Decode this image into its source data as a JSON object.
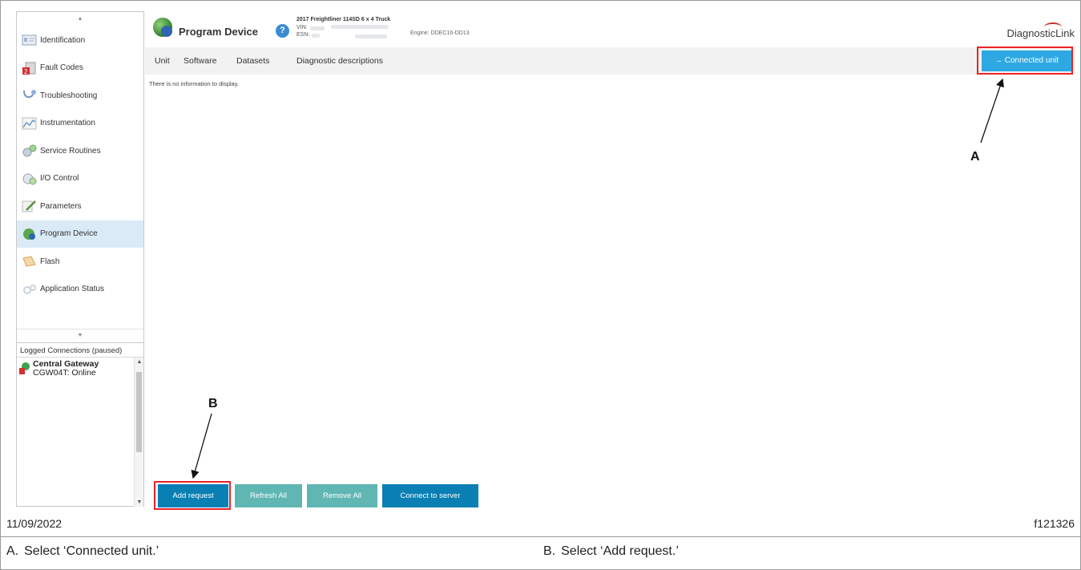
{
  "sidebar": {
    "items": [
      {
        "label": "Identification",
        "icon": "id-card-icon"
      },
      {
        "label": "Fault Codes",
        "icon": "fault-codes-icon"
      },
      {
        "label": "Troubleshooting",
        "icon": "stethoscope-icon"
      },
      {
        "label": "Instrumentation",
        "icon": "chart-icon"
      },
      {
        "label": "Service Routines",
        "icon": "gears-icon"
      },
      {
        "label": "I/O Control",
        "icon": "io-control-icon"
      },
      {
        "label": "Parameters",
        "icon": "pencil-icon"
      },
      {
        "label": "Program Device",
        "icon": "globe-icon",
        "active": true
      },
      {
        "label": "Flash",
        "icon": "flash-icon"
      },
      {
        "label": "Application Status",
        "icon": "status-icon"
      }
    ],
    "fault_badge": "2"
  },
  "logged": {
    "title": "Logged Connections (paused)",
    "connection_name": "Central Gateway",
    "connection_status": "CGW04T: Online"
  },
  "header": {
    "title": "Program Device",
    "help": "?",
    "vehicle": "2017 Freightliner 114SD 6 x 4 Truck",
    "vin_label": "VIN:",
    "esn_label": "ESN:",
    "engine": "Engine: DDEC16-DD13",
    "brand": "DiagnosticLink"
  },
  "tabs": [
    "Unit",
    "Software",
    "Datasets",
    "Diagnostic descriptions"
  ],
  "connected_unit": "→ Connected unit",
  "content": {
    "empty_message": "There is no information to display."
  },
  "buttons": {
    "add_request": "Add request",
    "refresh_all": "Refresh All",
    "remove_all": "Remove All",
    "connect_server": "Connect to server"
  },
  "callouts": {
    "a": "A",
    "b": "B"
  },
  "footer": {
    "date": "11/09/2022",
    "figure": "f121326"
  },
  "captions": [
    {
      "letter": "A.",
      "text": "Select ‘Connected unit.’"
    },
    {
      "letter": "B.",
      "text": "Select ‘Add request.’"
    }
  ],
  "colors": {
    "accent": "#2ea8e3",
    "primary_button": "#0a7fb4",
    "secondary_button": "#5fb6b3",
    "highlight": "#e8232a"
  }
}
